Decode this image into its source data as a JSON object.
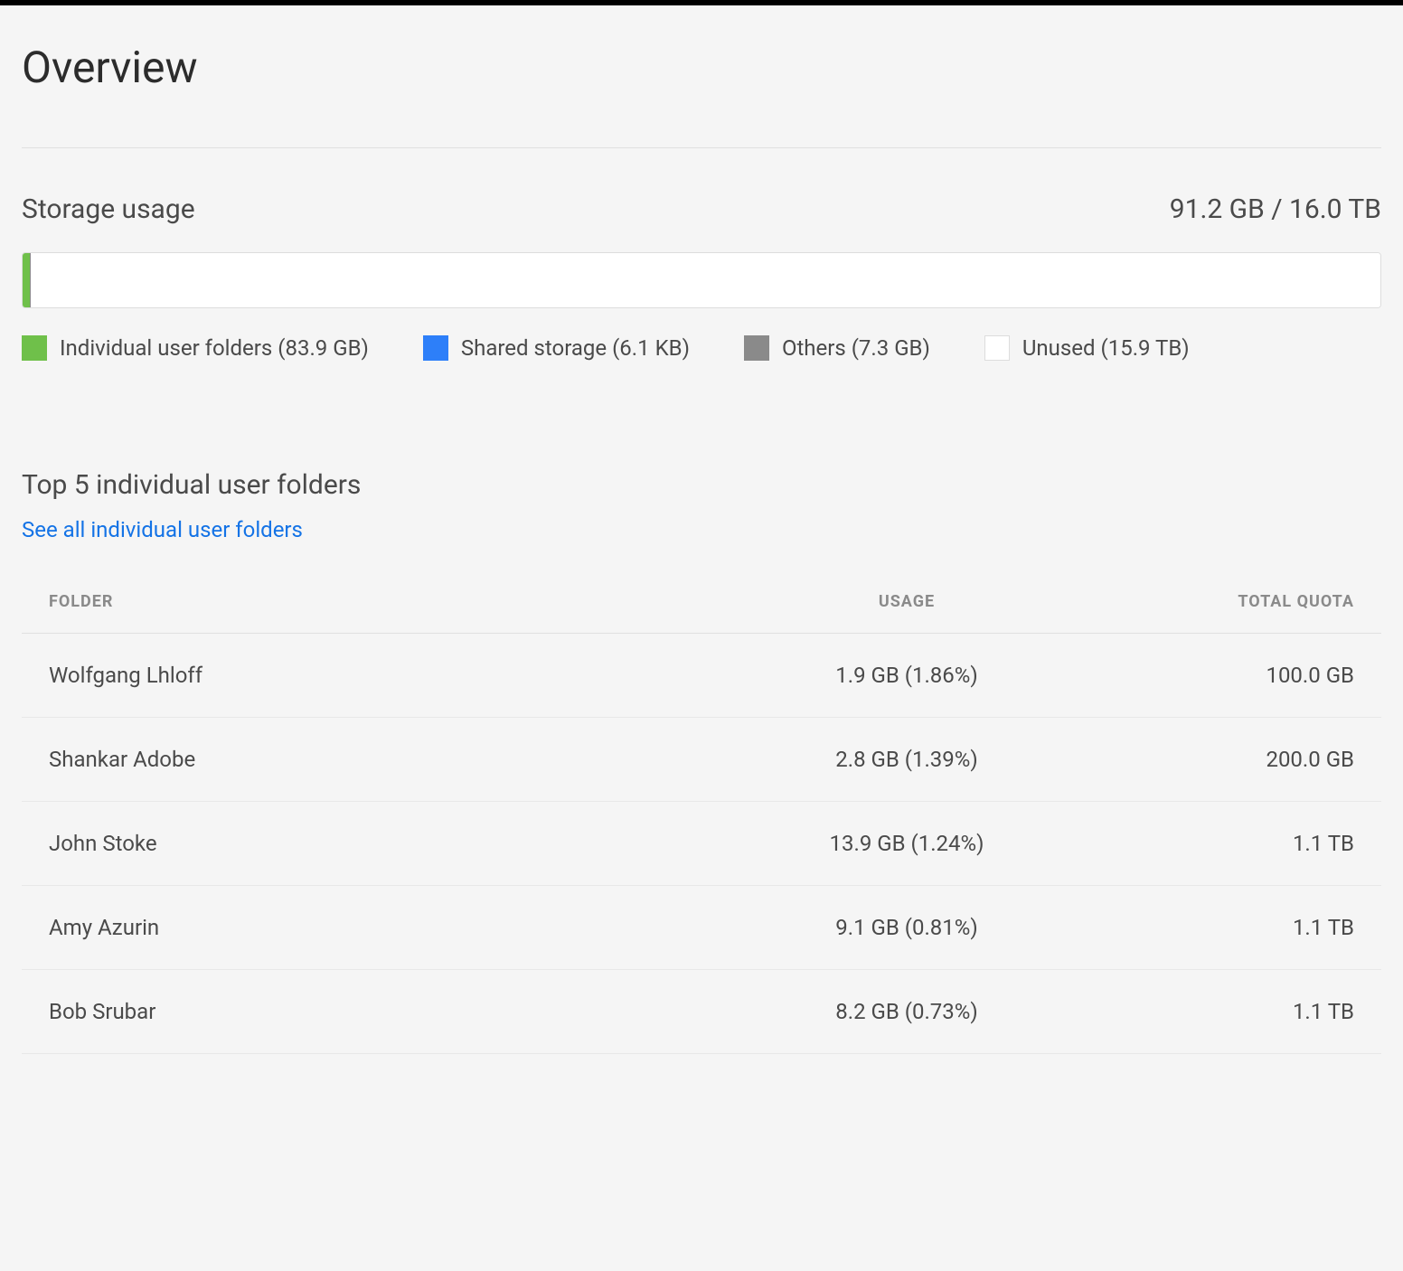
{
  "page_title": "Overview",
  "storage": {
    "section_label": "Storage usage",
    "summary": "91.2 GB / 16.0 TB",
    "segments": [
      {
        "label": "Individual user folders (83.9 GB)",
        "color": "#6fc04a",
        "width_pct": 0.55
      },
      {
        "label": "Shared storage (6.1 KB)",
        "color": "#2d7ff9",
        "width_pct": 0.0
      },
      {
        "label": "Others (7.3 GB)",
        "color": "#8a8a8a",
        "width_pct": 0.05
      },
      {
        "label": "Unused (15.9 TB)",
        "color": "#ffffff",
        "width_pct": 99.4
      }
    ],
    "legend_swatch_border": {
      "unused": "#ddd"
    }
  },
  "top_folders": {
    "section_label": "Top 5 individual user folders",
    "see_all_label": "See all individual user folders",
    "columns": {
      "folder": "FOLDER",
      "usage": "USAGE",
      "quota": "TOTAL QUOTA"
    },
    "rows": [
      {
        "folder": "Wolfgang Lhloff",
        "usage": "1.9 GB (1.86%)",
        "quota": "100.0 GB"
      },
      {
        "folder": "Shankar Adobe",
        "usage": "2.8 GB (1.39%)",
        "quota": "200.0 GB"
      },
      {
        "folder": "John Stoke",
        "usage": "13.9 GB (1.24%)",
        "quota": "1.1 TB"
      },
      {
        "folder": "Amy Azurin",
        "usage": "9.1 GB (0.81%)",
        "quota": "1.1 TB"
      },
      {
        "folder": "Bob Srubar",
        "usage": "8.2 GB (0.73%)",
        "quota": "1.1 TB"
      }
    ]
  }
}
